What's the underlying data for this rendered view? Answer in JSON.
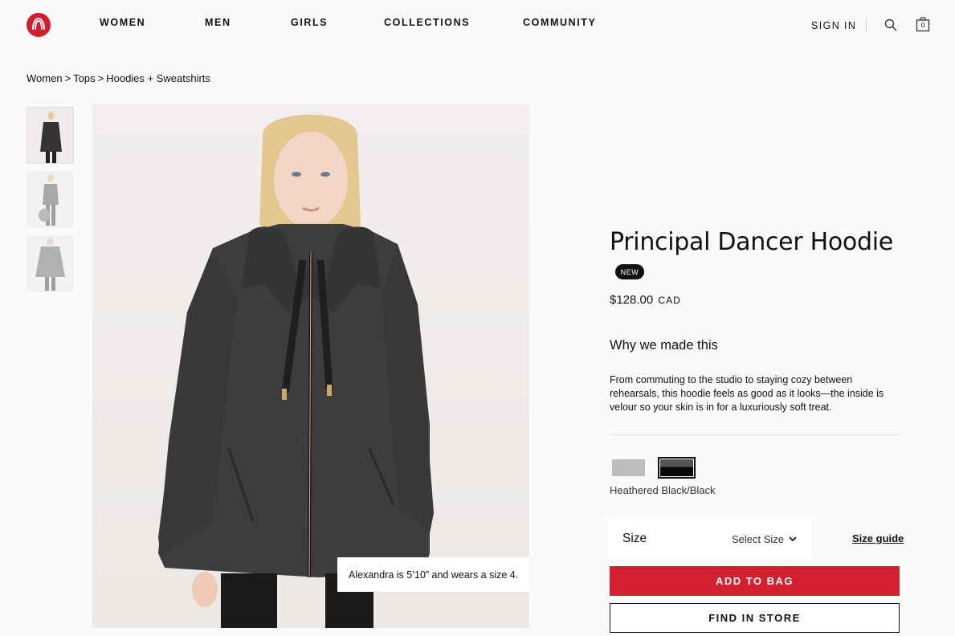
{
  "nav": {
    "items": [
      "WOMEN",
      "MEN",
      "GIRLS",
      "COLLECTIONS",
      "COMMUNITY"
    ],
    "sign_in": "SIGN IN",
    "bag_count": "0"
  },
  "breadcrumb": [
    "Women",
    "Tops",
    "Hoodies + Sweatshirts"
  ],
  "breadcrumb_separator": ">",
  "product": {
    "title": "Principal Dancer Hoodie",
    "badge": "NEW",
    "price": "$128.00",
    "currency": "CAD",
    "why_heading": "Why we made this",
    "description": "From commuting to the studio to staying cozy between rehearsals, this hoodie feels as good as it looks—the inside is velour so your skin is in for a luxuriously soft treat.",
    "color_name": "Heathered Black/Black",
    "swatch_colors": [
      "#bdbdbd",
      "#2b2b2b"
    ],
    "size_label": "Size",
    "size_value": "Select Size",
    "size_guide": "Size guide",
    "add_to_bag": "ADD TO BAG",
    "find_in_store": "FIND IN STORE"
  },
  "image_caption": "Alexandra is 5’10” and wears a size 4.",
  "colors": {
    "brand_red": "#d31e2e",
    "button_red": "#d22030"
  }
}
